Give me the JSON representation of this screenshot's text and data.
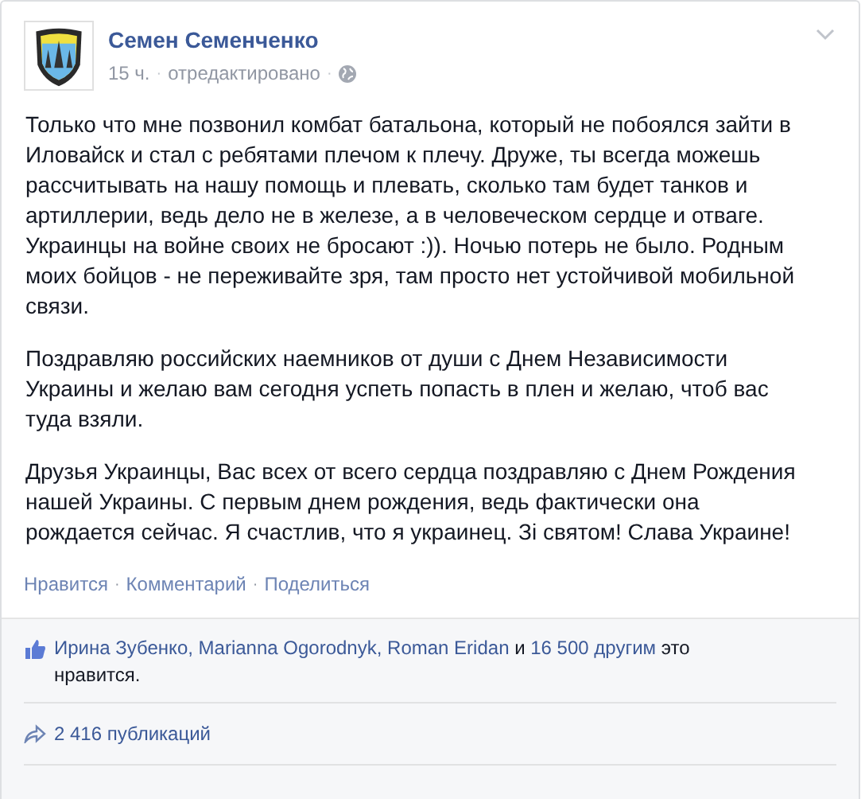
{
  "post": {
    "author": "Семен Семенченко",
    "meta": [
      {
        "kind": "link",
        "text": "15 ч."
      },
      {
        "kind": "dot",
        "text": "·"
      },
      {
        "kind": "link",
        "text": "отредактировано"
      },
      {
        "kind": "dot",
        "text": "·"
      }
    ],
    "paragraphs": [
      "Только что мне позвонил комбат батальона, который не побоялся зайти в Иловайск и стал с ребятами плечом к плечу. Друже, ты всегда можешь рассчитывать на нашу помощь и плевать, сколько там будет танков и артиллерии, ведь дело не в железе, а в человеческом сердце и отваге. Украинцы на войне своих не бросают :)). Ночью потерь не было. Родным моих бойцов - не переживайте зря, там просто нет устойчивой мобильной связи.",
      "Поздравляю российских наемников от души с Днем Независимости Украины и желаю вам сегодня успеть попасть в плен и желаю, чтоб вас туда взяли.",
      "Друзья Украинцы, Вас всех от всего сердца поздравляю с Днем Рождения нашей Украины. С первым днем рождения, ведь фактически она рождается сейчас. Я счастлив, что я украинец. Зі святом! Слава Украине!"
    ],
    "actions": [
      {
        "kind": "link",
        "text": "Нравится"
      },
      {
        "kind": "dot",
        "text": "·"
      },
      {
        "kind": "link",
        "text": "Комментарий"
      },
      {
        "kind": "dot",
        "text": "·"
      },
      {
        "kind": "link",
        "text": "Поделиться"
      }
    ],
    "likes": [
      {
        "kind": "link",
        "text": "Ирина Зубенко"
      },
      {
        "kind": "sep",
        "text": ", "
      },
      {
        "kind": "link",
        "text": "Marianna Ogorodnyk"
      },
      {
        "kind": "sep",
        "text": ", "
      },
      {
        "kind": "link",
        "text": "Roman Eridan"
      },
      {
        "kind": "plain",
        "text": " и "
      },
      {
        "kind": "link",
        "text": "16 500 другим"
      },
      {
        "kind": "plain",
        "text": " это нравится."
      }
    ],
    "shares": "2 416 публикаций"
  }
}
